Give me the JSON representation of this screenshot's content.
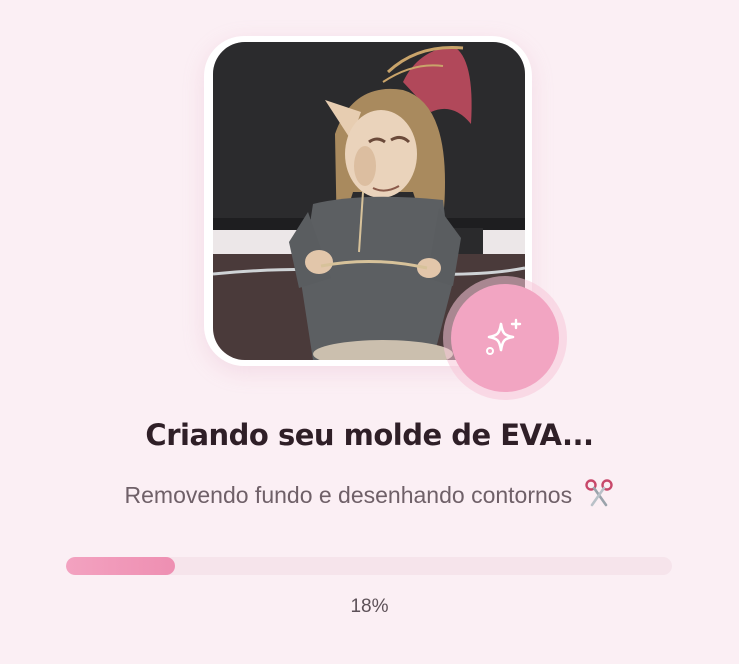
{
  "loading": {
    "title": "Criando seu molde de EVA...",
    "subtitle": "Removendo fundo e desenhando contornos",
    "subtitle_icon": "scissors-icon",
    "badge_icon": "sparkles-icon",
    "progress": {
      "fraction": 0.18,
      "label": "18%"
    }
  },
  "colors": {
    "background": "#fbeff4",
    "accent": "#f2a5c2",
    "progress_fill": "#ee8fb2",
    "progress_track": "#f6e4eb",
    "title": "#2f1f27"
  }
}
